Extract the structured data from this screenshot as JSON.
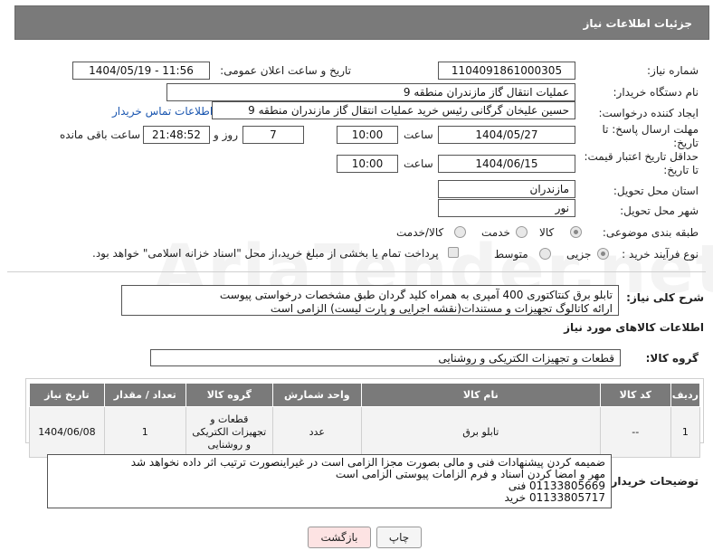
{
  "header": {
    "title": "جزئیات اطلاعات نیاز"
  },
  "form": {
    "need_number_label": "شماره نیاز:",
    "need_number": "1104091861000305",
    "announce_label": "تاریخ و ساعت اعلان عمومی:",
    "announce_value": "1404/05/19 - 11:56",
    "buyer_org_label": "نام دستگاه خریدار:",
    "buyer_org": "عملیات انتقال گاز مازندران منطقه 9",
    "creator_label": "ایجاد کننده درخواست:",
    "creator": "حسین علیخان گرگانی رئیس خرید عملیات انتقال گاز مازندران منطقه 9",
    "contact_link": "اطلاعات تماس خریدار",
    "deadline_label": "مهلت ارسال پاسخ: تا تاریخ:",
    "deadline_date": "1404/05/27",
    "time_label": "ساعت",
    "deadline_time": "10:00",
    "days": "7",
    "days_label": "روز و",
    "remaining": "21:48:52",
    "remaining_label": "ساعت باقی مانده",
    "validity_label": "حداقل تاریخ اعتبار قیمت: تا تاریخ:",
    "validity_date": "1404/06/15",
    "validity_time_label": "ساعت",
    "validity_time": "10:00",
    "province_label": "استان محل تحویل:",
    "province": "مازندران",
    "city_label": "شهر محل تحویل:",
    "city": "نور",
    "category_label": "طبقه بندی موضوعی:",
    "cat_options": [
      "کالا",
      "خدمت",
      "کالا/خدمت"
    ],
    "process_label": "نوع فرآیند خرید :",
    "process_options": [
      "جزیی",
      "متوسط"
    ],
    "process_note": "پرداخت تمام یا بخشی از مبلغ خرید،از محل \"اسناد خزانه اسلامی\" خواهد بود."
  },
  "summary": {
    "label": "شرح کلی نیاز:",
    "line1": "تابلو برق کنتاکتوری 400 آمپری به همراه کلید گردان طبق مشخصات درخواستی پیوست",
    "line2": "ارائه کاتالوگ تجهیزات و مستندات(نقشه اجرایی و پارت لیست) الزامی است"
  },
  "goods": {
    "section_title": "اطلاعات کالاهای مورد نیاز",
    "group_label": "گروه کالا:",
    "group_value": "قطعات و تجهیزات الکتریکی و روشنایی",
    "headers": [
      "ردیف",
      "کد کالا",
      "نام کالا",
      "واحد شمارش",
      "گروه کالا",
      "تعداد / مقدار",
      "تاریخ نیاز"
    ],
    "rows": [
      {
        "row": "1",
        "code": "--",
        "name": "تابلو برق",
        "unit": "عدد",
        "group": "قطعات و تجهیزات الکتریکی و روشنایی",
        "qty": "1",
        "date": "1404/06/08"
      }
    ]
  },
  "notes": {
    "label": "توضیحات خریدار:",
    "line1": "ضمیمه کردن پیشنهادات فنی و مالی بصورت مجزا الزامی است در غیراینصورت ترتیب اثر داده  نخواهد شد",
    "line2": "مهر و امضا کردن اسناد و فرم الزامات پیوستی الزامی است",
    "line3": "01133805669 فنی",
    "line4": "01133805717 خرید"
  },
  "buttons": {
    "print": "چاپ",
    "back": "بازگشت"
  },
  "watermark": "AriaTender.net",
  "colors": {
    "header_bg": "#7a7a7a",
    "link": "#1a56b0",
    "back_bg": "#fde3e3"
  }
}
